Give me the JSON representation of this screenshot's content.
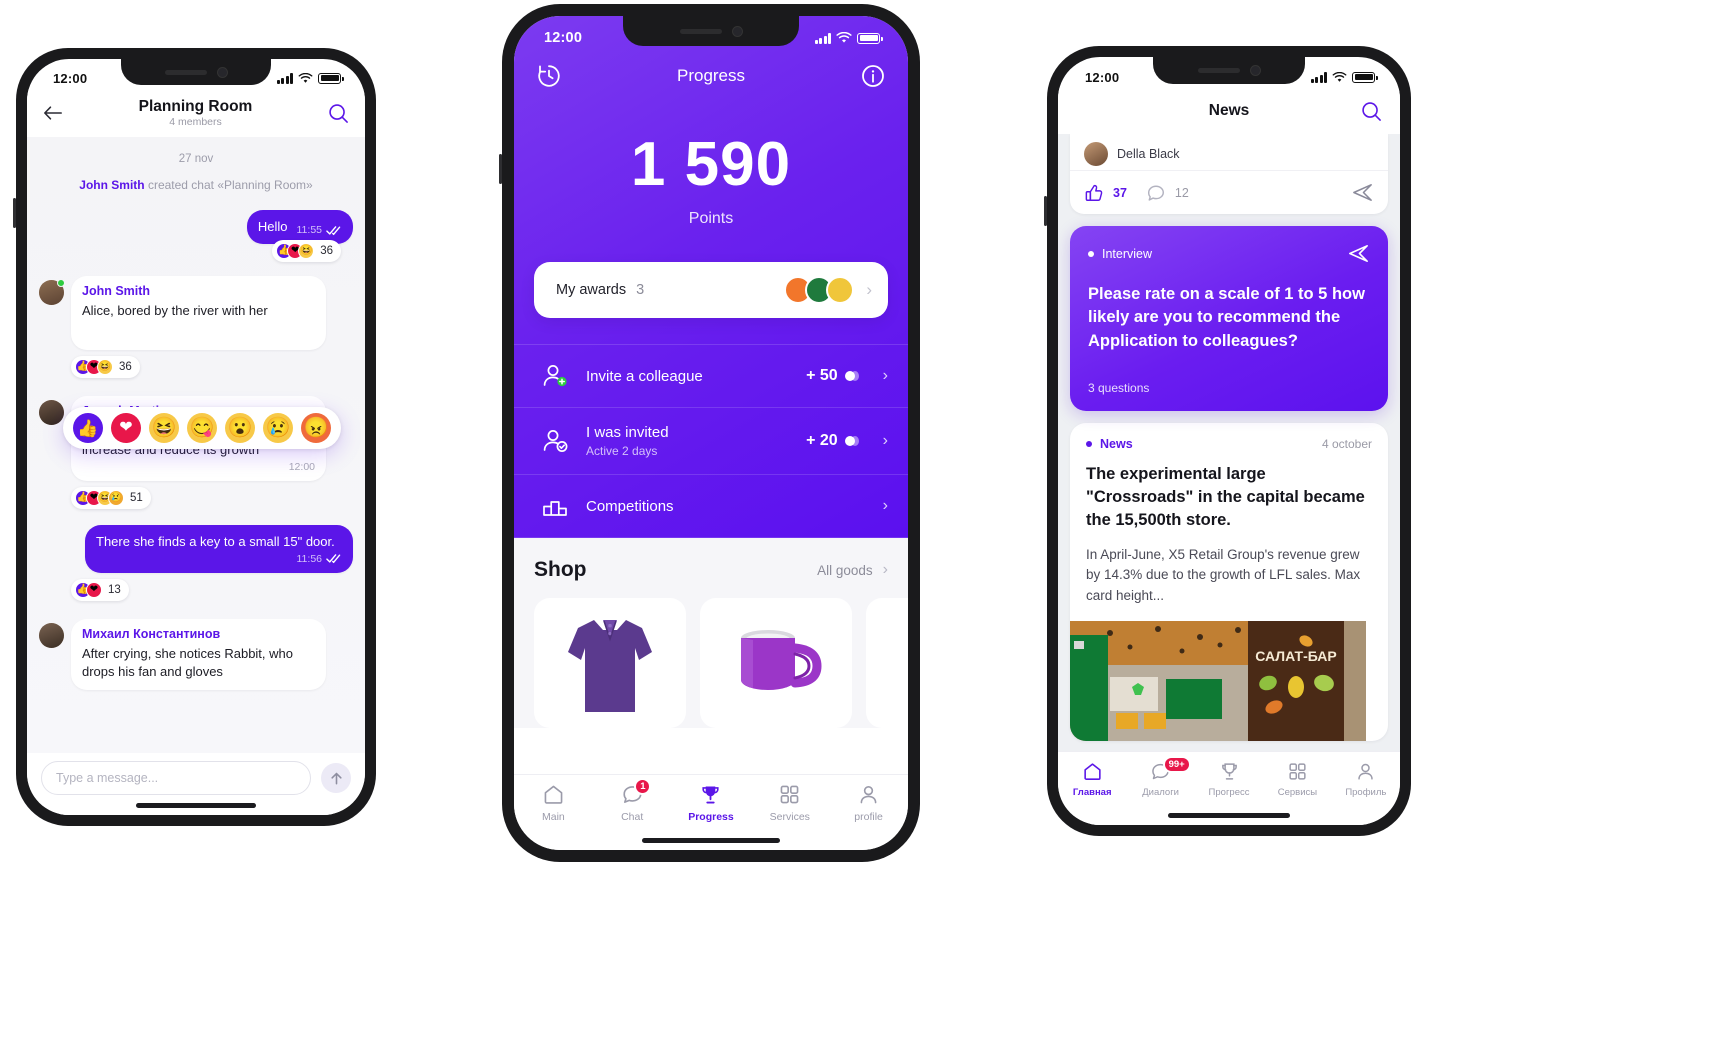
{
  "phone1": {
    "status": {
      "time": "12:00",
      "icons": [
        "signal-bars",
        "wifi",
        "battery"
      ]
    },
    "header": {
      "back_icon": "arrow-left-icon",
      "title": "Planning Room",
      "subtitle": "4 members",
      "search_icon": "search-icon"
    },
    "chat": {
      "day_separator": "27 nov",
      "system_message_actor": "John Smith",
      "system_message_rest": " created chat «Planning Room»",
      "messages": [
        {
          "side": "out",
          "text": "Hello",
          "time": "11:55",
          "status_icon": "double-check-icon",
          "reaction_count": "36",
          "reactions": [
            "like",
            "heart",
            "laugh"
          ]
        },
        {
          "side": "in",
          "author": "John Smith",
          "text": "Alice, bored by the river with her",
          "reaction_count": "36",
          "reactions": [
            "like",
            "heart",
            "laugh"
          ]
        },
        {
          "side": "in",
          "author": "Joseph Martinez",
          "text": "Alice discovers various items that increase and reduce its growth",
          "time": "12:00",
          "reaction_count": "51",
          "reactions": [
            "like",
            "heart",
            "laugh",
            "sad"
          ]
        },
        {
          "side": "out",
          "text": "There she finds a key to a small 15\" door.",
          "time": "11:56",
          "status_icon": "double-check-icon",
          "reaction_count": "13",
          "reactions": [
            "like",
            "heart"
          ]
        },
        {
          "side": "in",
          "author": "Михаил Константинов",
          "text": "After crying, she notices Rabbit, who drops his fan and gloves"
        }
      ],
      "reaction_picker": [
        {
          "name": "like",
          "glyph": "👍"
        },
        {
          "name": "heart",
          "glyph": "❤"
        },
        {
          "name": "laugh",
          "glyph": "😆"
        },
        {
          "name": "smile",
          "glyph": "😋"
        },
        {
          "name": "wow",
          "glyph": "😮"
        },
        {
          "name": "sad",
          "glyph": "😢"
        },
        {
          "name": "angry",
          "glyph": "😠"
        }
      ]
    },
    "composer": {
      "placeholder": "Type a message...",
      "send_icon": "arrow-up-icon"
    }
  },
  "phone2": {
    "status": {
      "time": "12:00"
    },
    "header": {
      "history_icon": "clock-history-icon",
      "title": "Progress",
      "info_icon": "info-icon"
    },
    "points": {
      "value": "1 590",
      "label": "Points"
    },
    "awards": {
      "label": "My awards",
      "count": "3",
      "chevron": "chevron-right-icon"
    },
    "items": [
      {
        "icon": "user-plus-icon",
        "title": "Invite a colleague",
        "subtitle": "",
        "points": "+ 50",
        "chevron": "chevron-right-icon"
      },
      {
        "icon": "user-check-icon",
        "title": "I was invited",
        "subtitle": "Active 2 days",
        "points": "+ 20",
        "chevron": "chevron-right-icon"
      },
      {
        "icon": "podium-icon",
        "title": "Competitions",
        "subtitle": "",
        "points": "",
        "chevron": "chevron-right-icon"
      }
    ],
    "shop": {
      "title": "Shop",
      "all_label": "All goods",
      "chevron": "chevron-right-icon",
      "products": [
        "polo-shirt",
        "mug",
        "partial-product"
      ]
    },
    "tabs": [
      {
        "label": "Main",
        "icon": "home-icon",
        "active": false,
        "badge": ""
      },
      {
        "label": "Chat",
        "icon": "chat-icon",
        "active": false,
        "badge": "1"
      },
      {
        "label": "Progress",
        "icon": "trophy-icon",
        "active": true,
        "badge": ""
      },
      {
        "label": "Services",
        "icon": "grid-icon",
        "active": false,
        "badge": ""
      },
      {
        "label": "profile",
        "icon": "person-icon",
        "active": false,
        "badge": ""
      }
    ]
  },
  "phone3": {
    "status": {
      "time": "12:00"
    },
    "header": {
      "title": "News",
      "search_icon": "search-icon"
    },
    "top_post": {
      "author": "Della Black",
      "like_icon": "thumbs-up-icon",
      "likes": "37",
      "comment_icon": "comment-icon",
      "comments": "12",
      "share_icon": "send-icon"
    },
    "survey": {
      "tag": "Interview",
      "send_icon": "send-icon",
      "question": "Please rate on a scale of 1 to 5 how likely are you to recommend the Application to colleagues?",
      "questions_count": "3 questions"
    },
    "news": {
      "tag": "News",
      "date": "4 october",
      "title": "The experimental large \"Crossroads\" in the capital became the 15,500th store.",
      "body": "In April-June, X5 Retail Group's revenue grew by 14.3% due to the growth of LFL sales. Max card height...",
      "image_label": "САЛАТ-БАР"
    },
    "tabs": [
      {
        "label": "Главная",
        "icon": "home-icon",
        "active": true,
        "badge": ""
      },
      {
        "label": "Диалоги",
        "icon": "chat-icon",
        "active": false,
        "badge": "99+"
      },
      {
        "label": "Прогресс",
        "icon": "trophy-icon",
        "active": false,
        "badge": ""
      },
      {
        "label": "Сервисы",
        "icon": "grid-icon",
        "active": false,
        "badge": ""
      },
      {
        "label": "Профиль",
        "icon": "person-icon",
        "active": false,
        "badge": ""
      }
    ]
  },
  "colors": {
    "brand_purple": "#5b16e8",
    "brand_purple_light": "#7c3bf0",
    "badge_red": "#e8174a",
    "online_green": "#2ecc40",
    "chat_bg": "#f4f4f7",
    "news_bg": "#eef0f3"
  }
}
